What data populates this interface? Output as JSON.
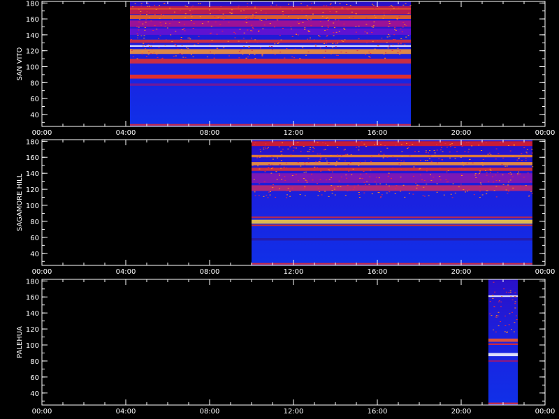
{
  "chart_data": [
    {
      "type": "heatmap",
      "ylabel": "SAN VITO",
      "xlabel": "",
      "title": "",
      "xlim_hours": [
        0,
        24
      ],
      "ylim": [
        25,
        182
      ],
      "x_ticks": [
        "00:00",
        "04:00",
        "08:00",
        "12:00",
        "16:00",
        "20:00",
        "00:00"
      ],
      "y_ticks": [
        "40",
        "60",
        "80",
        "100",
        "120",
        "140",
        "160",
        "180"
      ],
      "data_coverage_hours": [
        4.2,
        17.6
      ],
      "bands": [
        {
          "y": [
            166,
            176
          ],
          "color": "#d21e3c"
        },
        {
          "y": [
            172,
            173
          ],
          "color": "#ff7a10"
        },
        {
          "y": [
            160,
            165
          ],
          "color": "#ff6a10"
        },
        {
          "y": [
            150,
            158
          ],
          "color": "#b0128c"
        },
        {
          "y": [
            140,
            148
          ],
          "color": "#6a12d0"
        },
        {
          "y": [
            130,
            134
          ],
          "color": "#e23030"
        },
        {
          "y": [
            125,
            127
          ],
          "color": "#ffffff"
        },
        {
          "y": [
            116,
            122
          ],
          "color": "#ff9a30"
        },
        {
          "y": [
            104,
            110
          ],
          "color": "#e8302a"
        },
        {
          "y": [
            85,
            90
          ],
          "color": "#ff3010"
        },
        {
          "y": [
            76,
            79
          ],
          "color": "#7a1890"
        },
        {
          "y": [
            26,
            28
          ],
          "color": "#e82a2a"
        }
      ]
    },
    {
      "type": "heatmap",
      "ylabel": "SAGAMORE HILL",
      "xlabel": "",
      "title": "",
      "xlim_hours": [
        0,
        24
      ],
      "ylim": [
        25,
        182
      ],
      "x_ticks": [
        "00:00",
        "04:00",
        "08:00",
        "12:00",
        "16:00",
        "20:00",
        "00:00"
      ],
      "y_ticks": [
        "40",
        "60",
        "80",
        "100",
        "120",
        "140",
        "160",
        "180"
      ],
      "data_coverage_hours": [
        10.0,
        23.4
      ],
      "bands": [
        {
          "y": [
            174,
            180
          ],
          "color": "#e21e1e"
        },
        {
          "y": [
            160,
            163
          ],
          "color": "#ff8a20"
        },
        {
          "y": [
            150,
            154
          ],
          "color": "#ff9a30"
        },
        {
          "y": [
            143,
            147
          ],
          "color": "#e8342a"
        },
        {
          "y": [
            128,
            140
          ],
          "color": "#8a18b0"
        },
        {
          "y": [
            118,
            125
          ],
          "color": "#c82a6a"
        },
        {
          "y": [
            84,
            86
          ],
          "color": "#d02a3a"
        },
        {
          "y": [
            77,
            82
          ],
          "color": "#ffd23a"
        },
        {
          "y": [
            74,
            76
          ],
          "color": "#e8301e"
        },
        {
          "y": [
            56,
            59
          ],
          "color": "#2a1aa0"
        },
        {
          "y": [
            26,
            28
          ],
          "color": "#e82a2a"
        }
      ]
    },
    {
      "type": "heatmap",
      "ylabel": "PALEHUA",
      "xlabel": "",
      "title": "",
      "xlim_hours": [
        0,
        24
      ],
      "ylim": [
        25,
        182
      ],
      "x_ticks": [
        "00:00",
        "04:00",
        "08:00",
        "12:00",
        "16:00",
        "20:00",
        "00:00"
      ],
      "y_ticks": [
        "40",
        "60",
        "80",
        "100",
        "120",
        "140",
        "160",
        "180"
      ],
      "data_coverage_hours": [
        21.3,
        22.7
      ],
      "bands": [
        {
          "y": [
            160,
            162
          ],
          "color": "#ffffff"
        },
        {
          "y": [
            104,
            108
          ],
          "color": "#ff5a20"
        },
        {
          "y": [
            100,
            102
          ],
          "color": "#e82a2a"
        },
        {
          "y": [
            86,
            90
          ],
          "color": "#ffffff"
        },
        {
          "y": [
            79,
            81
          ],
          "color": "#a01870"
        },
        {
          "y": [
            26,
            28
          ],
          "color": "#e82a2a"
        }
      ]
    }
  ]
}
